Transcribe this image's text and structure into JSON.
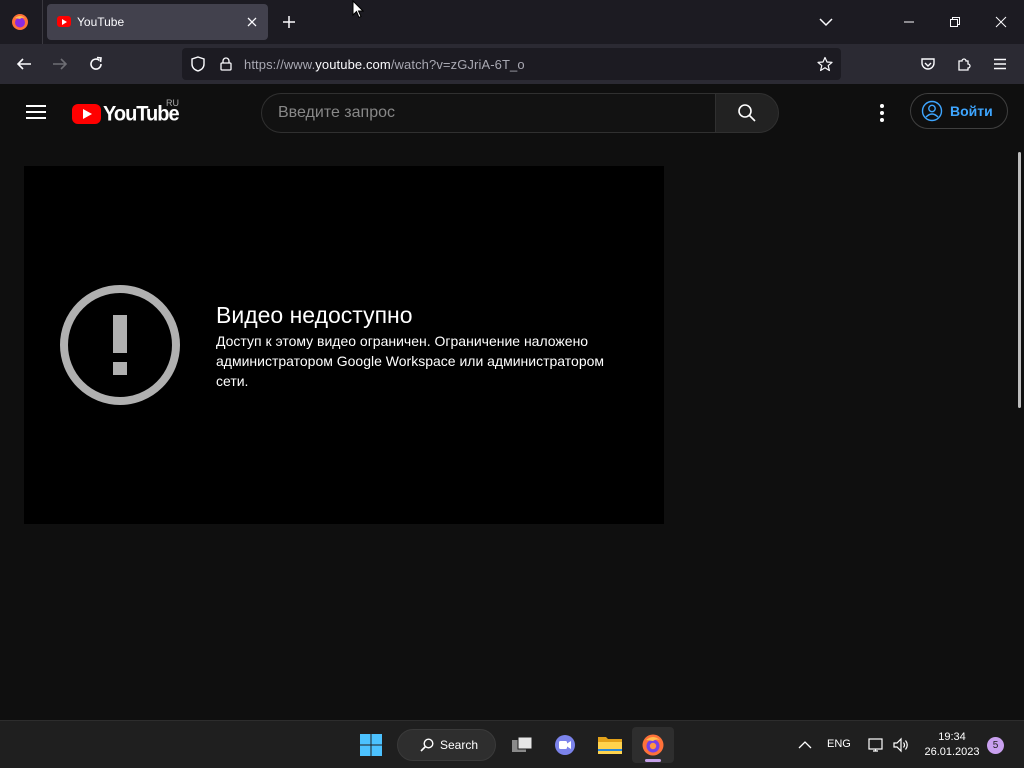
{
  "browser": {
    "tab": {
      "title": "YouTube"
    },
    "url": {
      "prefix": "https://www.",
      "host": "youtube.com",
      "path": "/watch?v=zGJriA-6T_o"
    }
  },
  "youtube": {
    "logo_text": "YouTube",
    "region": "RU",
    "search_placeholder": "Введите запрос",
    "signin_label": "Войти",
    "accent_red": "#ff0000",
    "link_blue": "#3ea6ff"
  },
  "player": {
    "error_title": "Видео недоступно",
    "error_message": "Доступ к этому видео ограничен. Ограничение наложено администратором Google Workspace или администратором сети."
  },
  "taskbar": {
    "search_label": "Search",
    "language": "ENG",
    "time": "19:34",
    "date": "26.01.2023",
    "notification_count": "5"
  }
}
